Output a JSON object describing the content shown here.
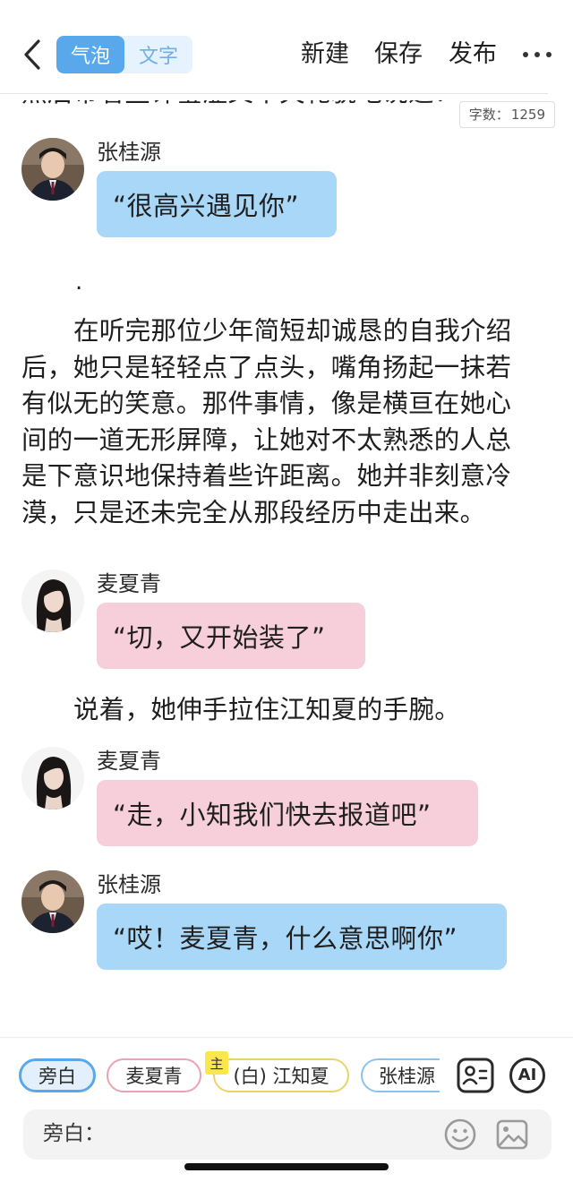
{
  "header": {
    "back_icon": "chevron-left-icon",
    "mode_bubble": "气泡",
    "mode_text": "文字",
    "new_label": "新建",
    "save_label": "保存",
    "publish_label": "发布",
    "more_icon": "more-dots-icon"
  },
  "story": {
    "cut_line": "然后带着些许羞涩又不失礼貌地说道：",
    "word_count_label": "字数：",
    "word_count_value": "1259",
    "dot_line": ".",
    "paragraph1": "在听完那位少年简短却诚恳的自我介绍后，她只是轻轻点了点头，嘴角扬起一抹若有似无的笑意。那件事情，像是横亘在她心间的一道无形屏障，让她对不太熟悉的人总是下意识地保持着些许距离。她并非刻意冷漠，只是还未完全从那段经历中走出来。",
    "paragraph2": "说着，她伸手拉住江知夏的手腕。",
    "messages": [
      {
        "speaker": "张桂源",
        "text": "“很高兴遇见你”",
        "color": "#a9d7f8"
      },
      {
        "speaker": "麦夏青",
        "text": "“切，又开始装了”",
        "color": "#f7cfdb"
      },
      {
        "speaker": "麦夏青",
        "text": "“走，小知我们快去报道吧”",
        "color": "#f7cfdb"
      },
      {
        "speaker": "张桂源",
        "text": "“哎！麦夏青，什么意思啊你”",
        "color": "#a9d7f8"
      }
    ]
  },
  "toolbar": {
    "chips": [
      "旁白",
      "麦夏青",
      "(白) 江知夏",
      "张桂源"
    ],
    "main_badge": "主",
    "role_icon": "role-card-icon",
    "ai_label": "AI",
    "input_label": "旁白：",
    "input_value": "",
    "input_placeholder": "",
    "emoji_icon": "emoji-icon",
    "image_icon": "image-icon"
  },
  "colors": {
    "accent": "#5aa8ec",
    "bubble_blue": "#a9d7f8",
    "bubble_pink": "#f7cfdb"
  }
}
